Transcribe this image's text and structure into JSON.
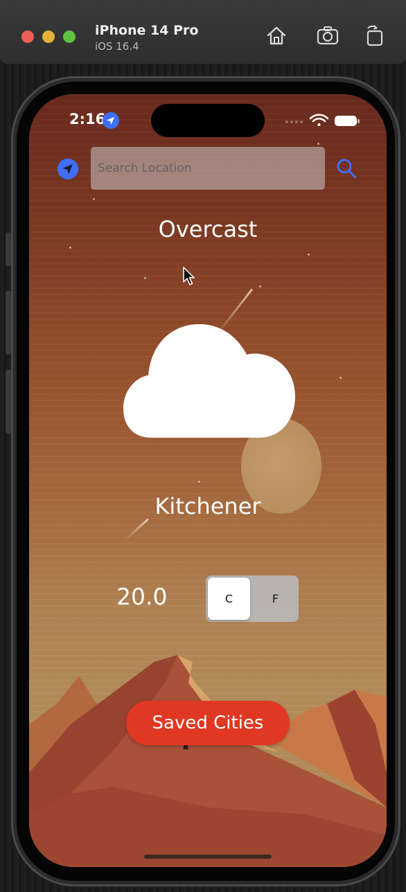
{
  "simulator": {
    "device": "iPhone 14 Pro",
    "os": "iOS 16.4",
    "icons": [
      "home-icon",
      "screenshot-icon",
      "rotate-icon"
    ]
  },
  "status_bar": {
    "time": "2:16",
    "icons": [
      "location-arrow-icon",
      "cellular-dots-icon",
      "wifi-icon",
      "battery-icon"
    ]
  },
  "search": {
    "placeholder": "Search Location",
    "value": ""
  },
  "weather": {
    "condition": "Overcast",
    "city": "Kitchener",
    "temperature": "20.0",
    "icon": "cloud-icon"
  },
  "unit_toggle": {
    "options": [
      "C",
      "F"
    ],
    "selected": "C"
  },
  "actions": {
    "saved_cities_label": "Saved Cities"
  },
  "colors": {
    "accent_blue": "#3f6fff",
    "saved_button": "#e03822",
    "sky_top": "#6a2a1e",
    "sky_bottom": "#b08a5a"
  }
}
